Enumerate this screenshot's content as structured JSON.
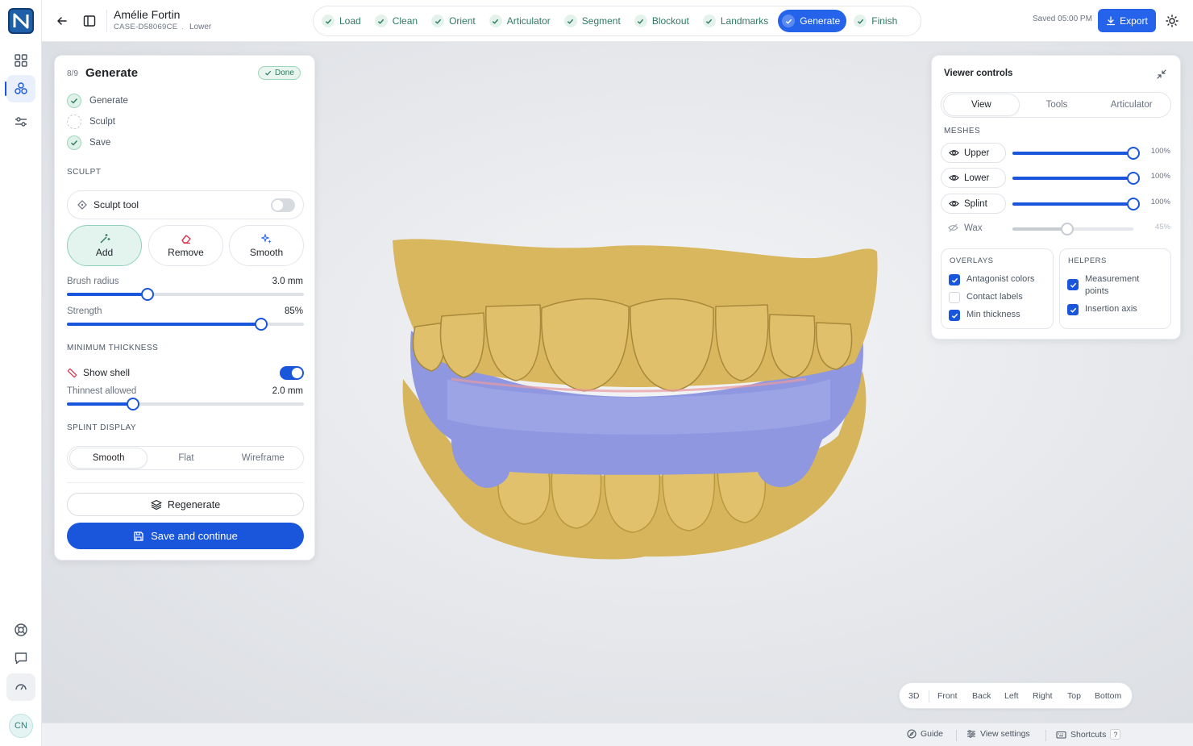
{
  "app": {
    "logo_letter": "N"
  },
  "patient": {
    "name": "Amélie Fortin",
    "case_id": "CASE-D58069CE",
    "jaw": "Lower",
    "separator": "·"
  },
  "steps": [
    {
      "label": "Load",
      "state": "done"
    },
    {
      "label": "Clean",
      "state": "done"
    },
    {
      "label": "Orient",
      "state": "done"
    },
    {
      "label": "Articulator",
      "state": "done"
    },
    {
      "label": "Segment",
      "state": "done"
    },
    {
      "label": "Blockout",
      "state": "done"
    },
    {
      "label": "Landmarks",
      "state": "done"
    },
    {
      "label": "Generate",
      "state": "active"
    },
    {
      "label": "Finish",
      "state": "done"
    }
  ],
  "header": {
    "saved": "Saved 05:00 PM",
    "export_label": "Export"
  },
  "panel": {
    "step_count": "8/9",
    "title": "Generate",
    "badge": "Done",
    "substeps": [
      {
        "label": "Generate",
        "state": "done"
      },
      {
        "label": "Sculpt",
        "state": "pending"
      },
      {
        "label": "Save",
        "state": "done"
      }
    ],
    "sculpt_section": "SCULPT",
    "sculpt_tool_label": "Sculpt tool",
    "sculpt_tool_enabled": false,
    "modes": [
      {
        "label": "Add",
        "active": true
      },
      {
        "label": "Remove",
        "active": false
      },
      {
        "label": "Smooth",
        "active": false
      }
    ],
    "brush_radius": {
      "label": "Brush radius",
      "value": "3.0 mm",
      "fraction": 0.34
    },
    "strength": {
      "label": "Strength",
      "value": "85%",
      "fraction": 0.82
    },
    "min_thickness_section": "MINIMUM THICKNESS",
    "show_shell": {
      "label": "Show shell",
      "enabled": true
    },
    "thinnest": {
      "label": "Thinnest allowed",
      "value": "2.0 mm",
      "fraction": 0.28
    },
    "splint_display_section": "SPLINT DISPLAY",
    "display_options": [
      {
        "label": "Smooth",
        "active": true
      },
      {
        "label": "Flat",
        "active": false
      },
      {
        "label": "Wireframe",
        "active": false
      }
    ],
    "regenerate_label": "Regenerate",
    "save_continue_label": "Save and continue"
  },
  "viewer": {
    "title": "Viewer controls",
    "tabs": [
      {
        "label": "View",
        "active": true
      },
      {
        "label": "Tools",
        "active": false
      },
      {
        "label": "Articulator",
        "active": false
      }
    ],
    "meshes_section": "MESHES",
    "meshes": [
      {
        "label": "Upper",
        "pct": "100%",
        "fraction": 1.0,
        "visible": true
      },
      {
        "label": "Lower",
        "pct": "100%",
        "fraction": 1.0,
        "visible": true
      },
      {
        "label": "Splint",
        "pct": "100%",
        "fraction": 1.0,
        "visible": true
      },
      {
        "label": "Wax",
        "pct": "45%",
        "fraction": 0.45,
        "visible": false
      }
    ],
    "overlays": {
      "title": "OVERLAYS",
      "items": [
        {
          "label": "Antagonist colors",
          "checked": true
        },
        {
          "label": "Contact labels",
          "checked": false
        },
        {
          "label": "Min thickness",
          "checked": true
        }
      ]
    },
    "helpers": {
      "title": "HELPERS",
      "items": [
        {
          "label": "Measurement points",
          "checked": true
        },
        {
          "label": "Insertion axis",
          "checked": true
        }
      ]
    }
  },
  "view_presets": [
    "3D",
    "Front",
    "Back",
    "Left",
    "Right",
    "Top",
    "Bottom"
  ],
  "footer": {
    "guide": "Guide",
    "view_settings": "View settings",
    "shortcuts": "Shortcuts",
    "shortcut_key": "?"
  },
  "user": {
    "initials": "CN"
  },
  "colors": {
    "accent": "#1a56db",
    "success": "#2f7a64",
    "model": "#d9b75e",
    "splint": "#8e97e0"
  }
}
